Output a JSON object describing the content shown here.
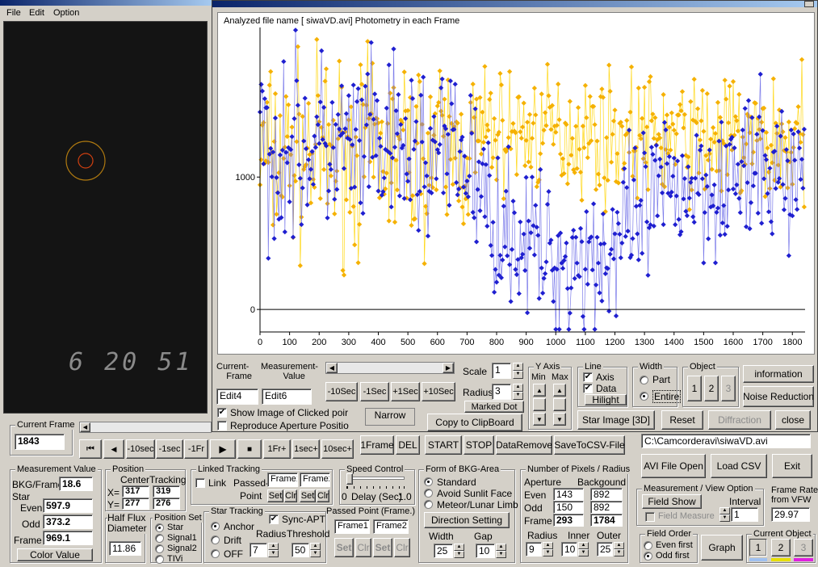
{
  "menu": {
    "file": "File",
    "edit": "Edit",
    "option": "Option"
  },
  "video": {
    "timestamp": "6 20 51"
  },
  "graph": {
    "header": "Analyzed file name [ siwaVD.avi]  Photometry in each Frame",
    "y_ticks": [
      "1000",
      "0"
    ],
    "x_ticks": [
      "0",
      "100",
      "200",
      "300",
      "400",
      "500",
      "600",
      "700",
      "800",
      "900",
      "1000",
      "1100",
      "1200",
      "1300",
      "1400",
      "1500",
      "1600",
      "1700",
      "1800"
    ],
    "colors": {
      "even": "#f5b100",
      "odd": "#1f1fd0",
      "yellow_line": "#ffd400"
    }
  },
  "chart_data": {
    "type": "line",
    "title": "Analyzed file name [ siwaVD.avi]  Photometry in each Frame",
    "xlabel": "",
    "ylabel": "",
    "xlim": [
      0,
      1843
    ],
    "ylim": [
      -170,
      2130
    ],
    "y_ticks": [
      0,
      1000
    ],
    "series": [
      {
        "segments": [
          [
            0,
            1150,
            800
          ],
          [
            700,
            1200,
            750
          ],
          [
            780,
            1350,
            500
          ],
          [
            1400,
            1300,
            500
          ],
          [
            1843,
            1250,
            600
          ]
        ]
      },
      {
        "segments": [
          [
            0,
            1250,
            800
          ],
          [
            700,
            1150,
            700
          ],
          [
            780,
            700,
            600
          ],
          [
            1000,
            350,
            600
          ],
          [
            1200,
            450,
            700
          ],
          [
            1400,
            950,
            650
          ],
          [
            1843,
            1050,
            600
          ]
        ]
      }
    ]
  },
  "controls": {
    "current_frame_label": "Current-\nFrame",
    "measurement_value_label": "Measurement-\nValue",
    "edit4": "Edit4",
    "edit6": "Edit6",
    "btn_m10": "-10Sec",
    "btn_m1": "-1Sec",
    "btn_p1": "+1Sec",
    "btn_p10": "+10Sec",
    "scale_label": "Scale",
    "scale_val": "1",
    "radius_label": "Radius",
    "radius_val": "3",
    "marked_dot": "Marked Dot",
    "copy_clip": "Copy to ClipBoard",
    "narrow": "Narrow",
    "show_image": "Show Image of Clicked poir",
    "reproduce": "Reproduce Aperture Positio",
    "yaxis_label": "Y Axis",
    "min": "Min",
    "max": "Max",
    "line_label": "Line",
    "axis": "Axis",
    "data": "Data",
    "hilight": "Hilight",
    "width_label": "Width",
    "part": "Part",
    "entire": "Entire",
    "object_label": "Object",
    "obj1": "1",
    "obj2": "2",
    "obj3": "3",
    "information": "information",
    "noise_reduction": "Noise Reduction",
    "star_image": "Star Image [3D]",
    "reset": "Reset",
    "diffraction": "Diffraction",
    "close": "close"
  },
  "main": {
    "current_frame_label": "Current Frame",
    "current_frame": "1843",
    "nav": {
      "b10": "-10sec",
      "b1": "-1sec",
      "f1": "-1Fr",
      "fplus": "1Fr+",
      "s1": "1sec+",
      "s10": "10sec+"
    },
    "actions": {
      "oneframe": "1Frame",
      "del": "DEL",
      "start": "START",
      "stop": "STOP",
      "dataremove": "DataRemove",
      "savecsv": "SaveToCSV-File"
    },
    "file_path": "C:\\Camcorderavi\\siwaVD.avi",
    "avi_open": "AVI File Open",
    "load_csv": "Load CSV",
    "exit": "Exit",
    "mv": {
      "label": "Measurement Value",
      "bkg": "BKG/Frame",
      "bkg_val": "18.6",
      "star": "Star",
      "even": "Even",
      "even_val": "597.9",
      "odd": "Odd",
      "odd_val": "373.2",
      "frame": "Frame",
      "frame_val": "969.1",
      "color_value": "Color Value"
    },
    "pos": {
      "label": "Position",
      "center": "Center",
      "tracking": "Tracking",
      "x": "X=",
      "y": "Y=",
      "xc": "317",
      "xt": "319",
      "yc": "277",
      "yt": "276"
    },
    "half": {
      "label": "Half Flux\nDiameter",
      "val": "11.86"
    },
    "posset": {
      "label": "Position Set",
      "star": "Star",
      "s1": "Signal1",
      "s2": "Signal2",
      "tivi": "TIVi"
    },
    "linked": {
      "label": "Linked Tracking",
      "link": "Link",
      "passed": "Passed-",
      "point": "Point",
      "f1": "Frame1",
      "f2": "Frame2",
      "set": "Set",
      "clr": "Clr"
    },
    "speed": {
      "label": "Speed Control",
      "zero": "0",
      "delay": "Delay (Sec)",
      "one": "1.0"
    },
    "startrack": {
      "label": "Star Tracking",
      "anchor": "Anchor",
      "drift": "Drift",
      "off": "OFF",
      "sync": "Sync-APT",
      "radius": "Radius",
      "threshold": "Threshold",
      "radius_val": "7",
      "thr_val": "50"
    },
    "passed": {
      "label": "Passed Point (Frame.)",
      "f1": "Frame1",
      "f2": "Frame2",
      "set": "Set",
      "clr": "Clr"
    },
    "bkg": {
      "label": "Form of BKG-Area",
      "standard": "Standard",
      "avoid": "Avoid Sunlit Face",
      "meteor": "Meteor/Lunar Limb",
      "direction": "Direction Setting",
      "width": "Width",
      "gap": "Gap",
      "width_val": "25",
      "gap_val": "10"
    },
    "pix": {
      "label": "Number of Pixels / Radius",
      "aperture": "Aperture",
      "background": "Backgound",
      "even": "Even",
      "odd": "Odd",
      "frame": "Frame",
      "ea": "143",
      "eb": "892",
      "oa": "150",
      "ob": "892",
      "fa": "293",
      "fb": "1784",
      "radius": "Radius",
      "inner": "Inner",
      "outer": "Outer",
      "rv": "9",
      "iv": "10",
      "ov": "25"
    },
    "view": {
      "label": "Measurement / View Option",
      "field_show": "Field Show",
      "field_measure": "Field Measure",
      "interval": "Interval",
      "interval_val": "1"
    },
    "framerate": {
      "label": "Frame Rate\nfrom VFW",
      "val": "29.97"
    },
    "fieldorder": {
      "label": "Field Order",
      "even": "Even first",
      "odd": "Odd first"
    },
    "graph_btn": "Graph",
    "curobj": {
      "label": "Current Object",
      "o1": "1",
      "o2": "2",
      "o3": "3"
    }
  }
}
